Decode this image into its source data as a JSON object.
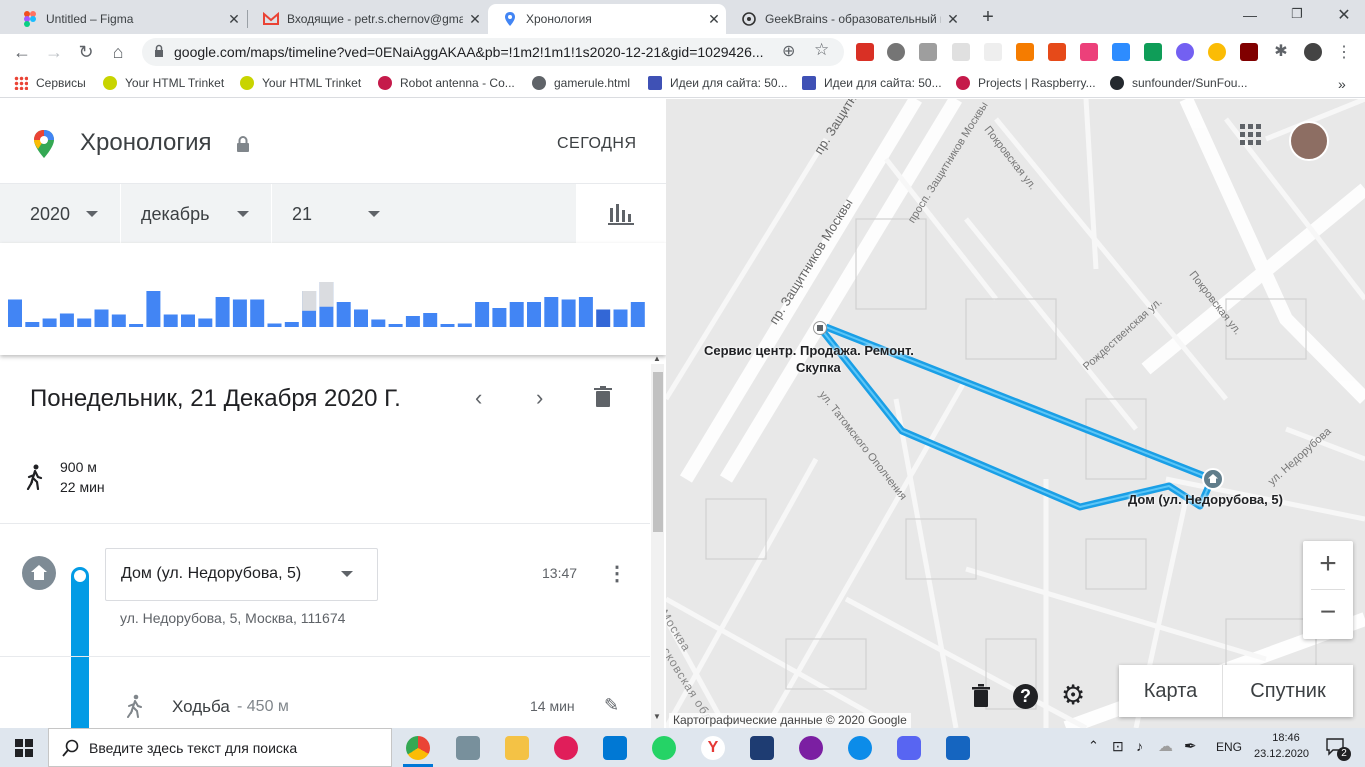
{
  "browser": {
    "tabs": [
      {
        "title": "Untitled – Figma",
        "icon": "figma-icon",
        "active": false
      },
      {
        "title": "Входящие - petr.s.chernov@gma",
        "icon": "gmail-icon",
        "active": false
      },
      {
        "title": "Хронология",
        "icon": "maps-pin-icon",
        "active": true
      },
      {
        "title": "GeekBrains - образовательный п",
        "icon": "openai-like-icon",
        "active": false
      }
    ],
    "new_tab": "+",
    "url": "google.com/maps/timeline?ved=0ENaiAggAKAA&pb=!1m2!1m1!1s2020-12-21&gid=1029426..."
  },
  "bookmarks": [
    {
      "label": "Сервисы",
      "icon": "apps-icon"
    },
    {
      "label": "Your HTML Trinket",
      "icon": "trinket-icon"
    },
    {
      "label": "Your HTML Trinket",
      "icon": "trinket-icon"
    },
    {
      "label": "Robot antenna - Co...",
      "icon": "raspberry-icon"
    },
    {
      "label": "gamerule.html",
      "icon": "globe-icon"
    },
    {
      "label": "Идеи для сайта: 50...",
      "icon": "wix-icon"
    },
    {
      "label": "Идеи для сайта: 50...",
      "icon": "wix-icon"
    },
    {
      "label": "Projects | Raspberry...",
      "icon": "raspberry-icon"
    },
    {
      "label": "sunfounder/SunFou...",
      "icon": "github-icon"
    }
  ],
  "timeline": {
    "title": "Хронология",
    "today_button": "СЕГОДНЯ",
    "year": "2020",
    "month": "декабрь",
    "day": "21",
    "histogram_values": [
      0.55,
      0.1,
      0.17,
      0.27,
      0.17,
      0.35,
      0.25,
      0.05,
      0.72,
      0.25,
      0.25,
      0.17,
      0.6,
      0.55,
      0.55,
      0.07,
      0.1,
      0.72,
      0.9,
      0.5,
      0.35,
      0.15,
      0.05,
      0.22,
      0.28,
      0.05,
      0.07,
      0.5,
      0.38,
      0.5,
      0.5,
      0.6,
      0.55,
      0.6,
      0.35,
      0.35,
      0.5
    ],
    "date_heading": "Понедельник, 21 Декабря 2020 Г.",
    "summary_distance": "900 м",
    "summary_time": "22 мин",
    "place_name": "Дом (ул. Недорубова, 5)",
    "place_time": "13:47",
    "place_address": "ул. Недорубова, 5, Москва, 111674",
    "activity_label": "Ходьба",
    "activity_distance": "- 450 м",
    "activity_duration": "14 мин"
  },
  "map": {
    "label_service": "Сервис центр. Продажа. Ремонт.",
    "label_service2": "Скупка",
    "label_home": "Дом (ул. Недорубова, 5)",
    "street_1": "пр. Защитников Москвы",
    "street_2": "просп. Защитников Москвы",
    "street_3": "Рождественская ул.",
    "street_4": "Покровская ул.",
    "street_5": "ул. Недорубова",
    "street_6": "Покровская ул.",
    "street_7": "ул. Татомского Ополчения",
    "street_8": "Москва",
    "street_9": "Московская обл.",
    "zoom_in": "+",
    "zoom_out": "−",
    "btn_map": "Карта",
    "btn_satellite": "Спутник",
    "copyright": "Картографические данные © 2020 Google",
    "route_color": "#1a9fe6"
  },
  "taskbar": {
    "search_placeholder": "Введите здесь текст для поиска",
    "lang": "ENG",
    "time": "18:46",
    "date": "23.12.2020",
    "notifications": "2"
  }
}
